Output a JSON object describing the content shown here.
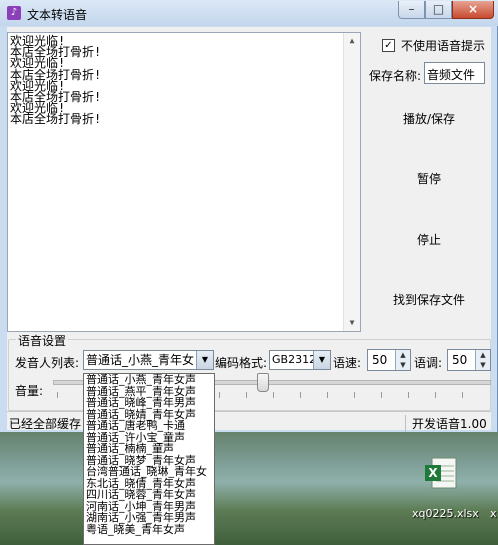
{
  "window": {
    "title": "文本转语音"
  },
  "editor": {
    "lines": [
      "欢迎光临!",
      "本店全场打骨折!",
      "欢迎光临!",
      "本店全场打骨折!",
      "欢迎光临!",
      "本店全场打骨折!",
      "欢迎光临!",
      "本店全场打骨折!"
    ]
  },
  "options": {
    "no_prompt_label": "不使用语音提示",
    "no_prompt_checked": true
  },
  "save": {
    "name_label": "保存名称:",
    "name_value": "音频文件"
  },
  "actions": {
    "play_save": "播放/保存",
    "pause": "暂停",
    "stop": "停止",
    "find_file": "找到保存文件"
  },
  "voice_settings": {
    "group_title": "语音设置",
    "speaker_label": "发音人列表:",
    "speaker_value": "普通话_小燕_青年女",
    "encoding_label": "编码格式:",
    "encoding_value": "GB2312",
    "speed_label": "语速:",
    "speed_value": "50",
    "pitch_label": "语调:",
    "pitch_value": "50",
    "volume_label": "音量:",
    "volume_level": 0.48
  },
  "status": {
    "left": "已经全部缓存",
    "right": "开发语音1.00"
  },
  "speaker_options": [
    "普通话_小燕_青年女声",
    "普通话_燕平_青年女声",
    "普通话_晓峰_青年男声",
    "普通话_晓婧_青年女声",
    "普通话_唐老鸭_卡通",
    "普通话_许小宝_童声",
    "普通话_楠楠_童声",
    "普通话_晓梦_青年女声",
    "台湾普通话_晓琳_青年女",
    "东北话_晓倩_青年女声",
    "四川话_晓蓉_青年女声",
    "河南话_小坤_青年男声",
    "湖南话_小强_青年男声",
    "粤语_晓美_青年女声"
  ],
  "desktop": {
    "file_label": "xq0225.xlsx",
    "file_label_cut": "x"
  }
}
